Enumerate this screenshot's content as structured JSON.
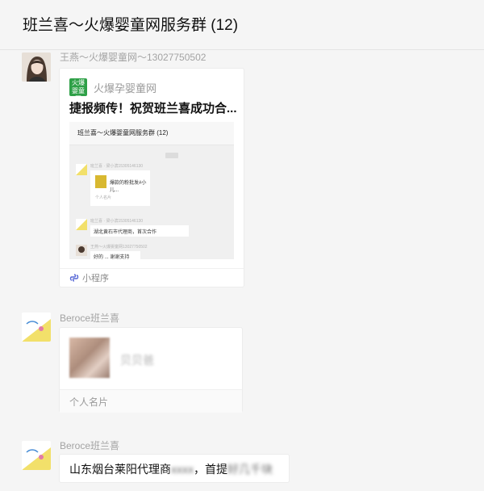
{
  "header": {
    "title": "班兰喜～火爆婴童网服务群 (12)"
  },
  "messages": [
    {
      "sender": "王燕～火爆婴童网～13027750502",
      "type": "mini-program",
      "card": {
        "logo_text": "火爆婴童网",
        "app_name": "火爆孕婴童网",
        "title": "捷报频传！祝贺班兰喜成功合...",
        "preview": {
          "chat_title": "班兰喜～火爆婴童网服务群 (12)",
          "line1": "班兰喜 · 梁小滨15305146130",
          "bubble1": "爆款的粉批发#小儿...",
          "bubble1_sub": "个人名片",
          "line2": "班兰喜 · 梁小滨15305146130",
          "bubble2": "湖北黄石市代理商，首次合作",
          "line3": "王燕～火爆婴童网13027750502",
          "bubble3": "好的 ... 谢谢支持"
        },
        "footer": "小程序"
      }
    },
    {
      "sender": "Beroce班兰喜",
      "type": "contact-card",
      "card": {
        "name": "贝贝爸",
        "footer": "个人名片"
      }
    },
    {
      "sender": "Beroce班兰喜",
      "type": "text",
      "text_prefix": "山东烟台莱阳代理商",
      "text_blur1": "xxxx",
      "text_middle": "，首提",
      "text_blur2": "好几千块"
    }
  ],
  "colors": {
    "accent_green": "#2ea047",
    "link_blue": "#5a6ad6",
    "avatar_yellow": "#f2e06a"
  }
}
